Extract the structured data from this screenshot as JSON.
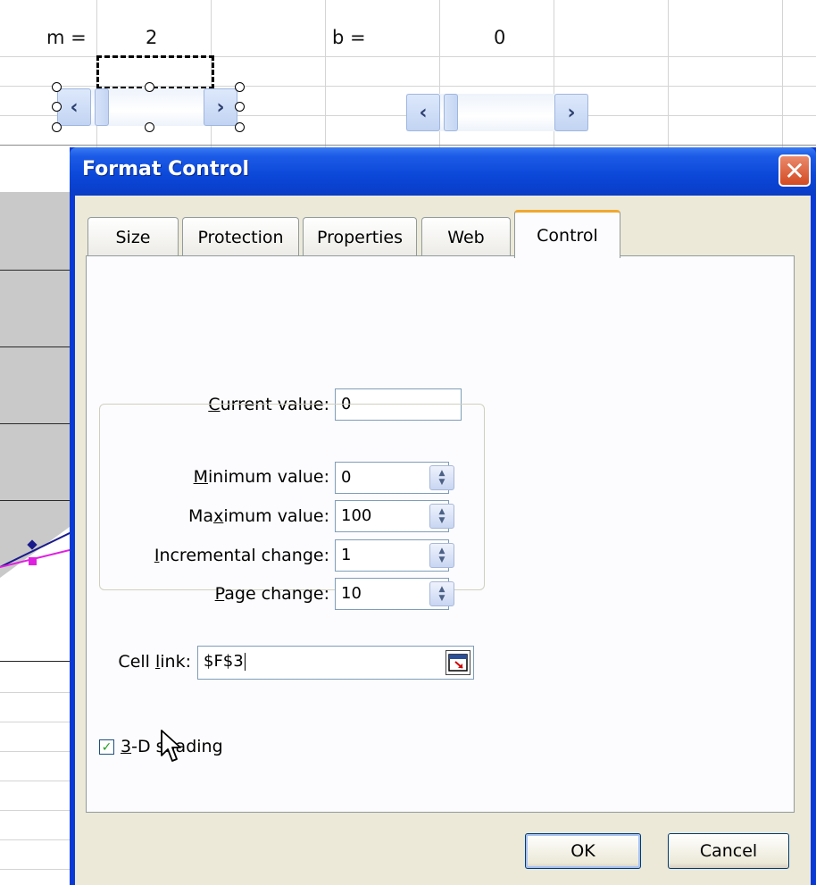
{
  "sheet": {
    "m_label": "m =",
    "m_value": "2",
    "b_label": "b =",
    "b_value": "0"
  },
  "dialog": {
    "title": "Format Control",
    "close_glyph": "✕",
    "tabs": [
      {
        "label": "Size",
        "active": false
      },
      {
        "label": "Protection",
        "active": false
      },
      {
        "label": "Properties",
        "active": false
      },
      {
        "label": "Web",
        "active": false
      },
      {
        "label": "Control",
        "active": true
      }
    ],
    "control": {
      "current_value": {
        "label_pre": "",
        "label_u": "C",
        "label_post": "urrent value:",
        "value": "0"
      },
      "minimum_value": {
        "label_pre": "",
        "label_u": "M",
        "label_post": "inimum value:",
        "value": "0"
      },
      "maximum_value": {
        "label_pre": "Ma",
        "label_u": "x",
        "label_post": "imum value:",
        "value": "100"
      },
      "incremental_change": {
        "label_pre": "",
        "label_u": "I",
        "label_post": "ncremental change:",
        "value": "1"
      },
      "page_change": {
        "label_pre": "",
        "label_u": "P",
        "label_post": "age change:",
        "value": "10"
      },
      "cell_link": {
        "label_pre": "Cell ",
        "label_u": "l",
        "label_post": "ink:",
        "value": "$F$3"
      },
      "shading": {
        "label_u": "3",
        "label_post": "-D shading",
        "checked": true
      }
    },
    "buttons": {
      "ok": "OK",
      "cancel": "Cancel"
    }
  },
  "colors": {
    "titlebar": "#0b47d8",
    "dialog_face": "#ece9d8",
    "active_tab_accent": "#f0a830",
    "close_button": "#d34a22"
  },
  "icons": [
    "close-icon",
    "spin-up-down-icon",
    "collapse-dialog-icon",
    "checkmark-icon",
    "mouse-pointer-icon",
    "chevron-left-icon",
    "chevron-right-icon"
  ]
}
